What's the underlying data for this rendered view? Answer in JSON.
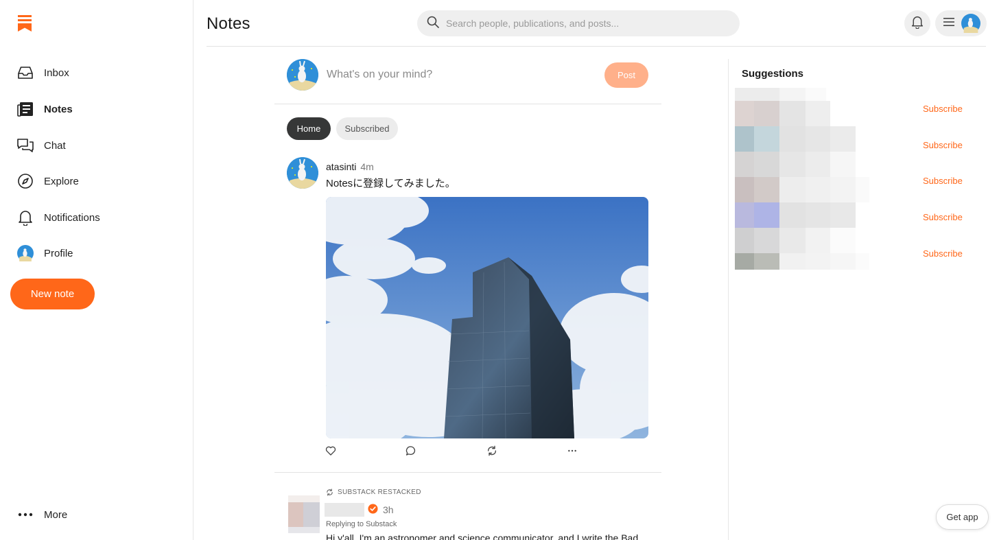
{
  "sidebar": {
    "items": [
      {
        "label": "Inbox",
        "icon": "inbox-icon"
      },
      {
        "label": "Notes",
        "icon": "notes-icon"
      },
      {
        "label": "Chat",
        "icon": "chat-icon"
      },
      {
        "label": "Explore",
        "icon": "compass-icon"
      },
      {
        "label": "Notifications",
        "icon": "bell-icon"
      },
      {
        "label": "Profile",
        "icon": "avatar"
      }
    ],
    "new_note_label": "New note",
    "more_label": "More"
  },
  "header": {
    "title": "Notes",
    "search_placeholder": "Search people, publications, and posts..."
  },
  "composer": {
    "placeholder": "What's on your mind?",
    "post_label": "Post"
  },
  "tabs": [
    {
      "label": "Home",
      "active": true
    },
    {
      "label": "Subscribed",
      "active": false
    }
  ],
  "post": {
    "author": "atasinti",
    "time": "4m",
    "text": "Notesに登録してみました。"
  },
  "restack": {
    "label": "SUBSTACK RESTACKED",
    "time": "3h",
    "replying": "Replying to Substack",
    "text": "Hi y'all. I'm an astronomer and science communicator, and I write the Bad"
  },
  "suggestions": {
    "title": "Suggestions",
    "subscribe_label": "Subscribe",
    "count": 5
  },
  "get_app_label": "Get app",
  "colors": {
    "accent": "#ff6719",
    "accent_light": "#ffb08a",
    "tab_active": "#363737"
  }
}
